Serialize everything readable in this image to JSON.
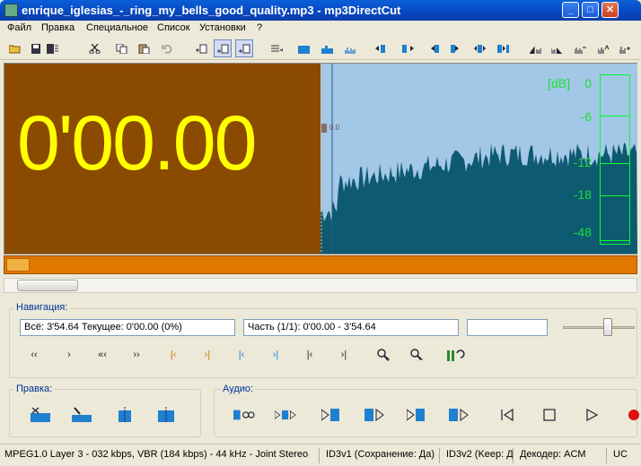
{
  "window": {
    "title": "enrique_iglesias_-_ring_my_bells_good_quality.mp3 - mp3DirectCut",
    "minimize_label": "_",
    "maximize_label": "□",
    "close_label": "✕"
  },
  "menu": [
    "Файл",
    "Правка",
    "Специальное",
    "Список",
    "Установки",
    "?"
  ],
  "display": {
    "time": "0'00.00",
    "marker_value": "0.0",
    "db_unit": "[dB]",
    "db_labels": [
      "0",
      "-6",
      "-12",
      "-18",
      "-48"
    ],
    "colors": {
      "time_bg": "#8a4a00",
      "time_fg": "#ffff00",
      "wave_bg": "#a3c7e6",
      "wave_fg": "#0e5a70",
      "meter": "#00ff30"
    }
  },
  "navigation": {
    "label": "Навигация:",
    "total_current": "Всё: 3'54.64   Текущее: 0'00.00   (0%)",
    "part": "Часть (1/1): 0'00.00 - 3'54.64",
    "extra": "",
    "buttons": [
      "‹‹",
      "›",
      "«‹",
      "››",
      "|‹",
      "›|",
      "|‹",
      "›|",
      "|‹",
      "›|",
      "zoom-in",
      "zoom-out",
      "ii"
    ]
  },
  "edit": {
    "label": "Правка:"
  },
  "audio": {
    "label": "Аудио:"
  },
  "status": {
    "format": "MPEG1.0 Layer 3 - 032 kbps, VBR (184 kbps) - 44 kHz - Joint Stereo",
    "id3v1": "ID3v1 (Сохранение: Да)",
    "id3v2": "ID3v2 (Keep: Д",
    "decoder": "Декодер: ACM",
    "last": "UC"
  }
}
